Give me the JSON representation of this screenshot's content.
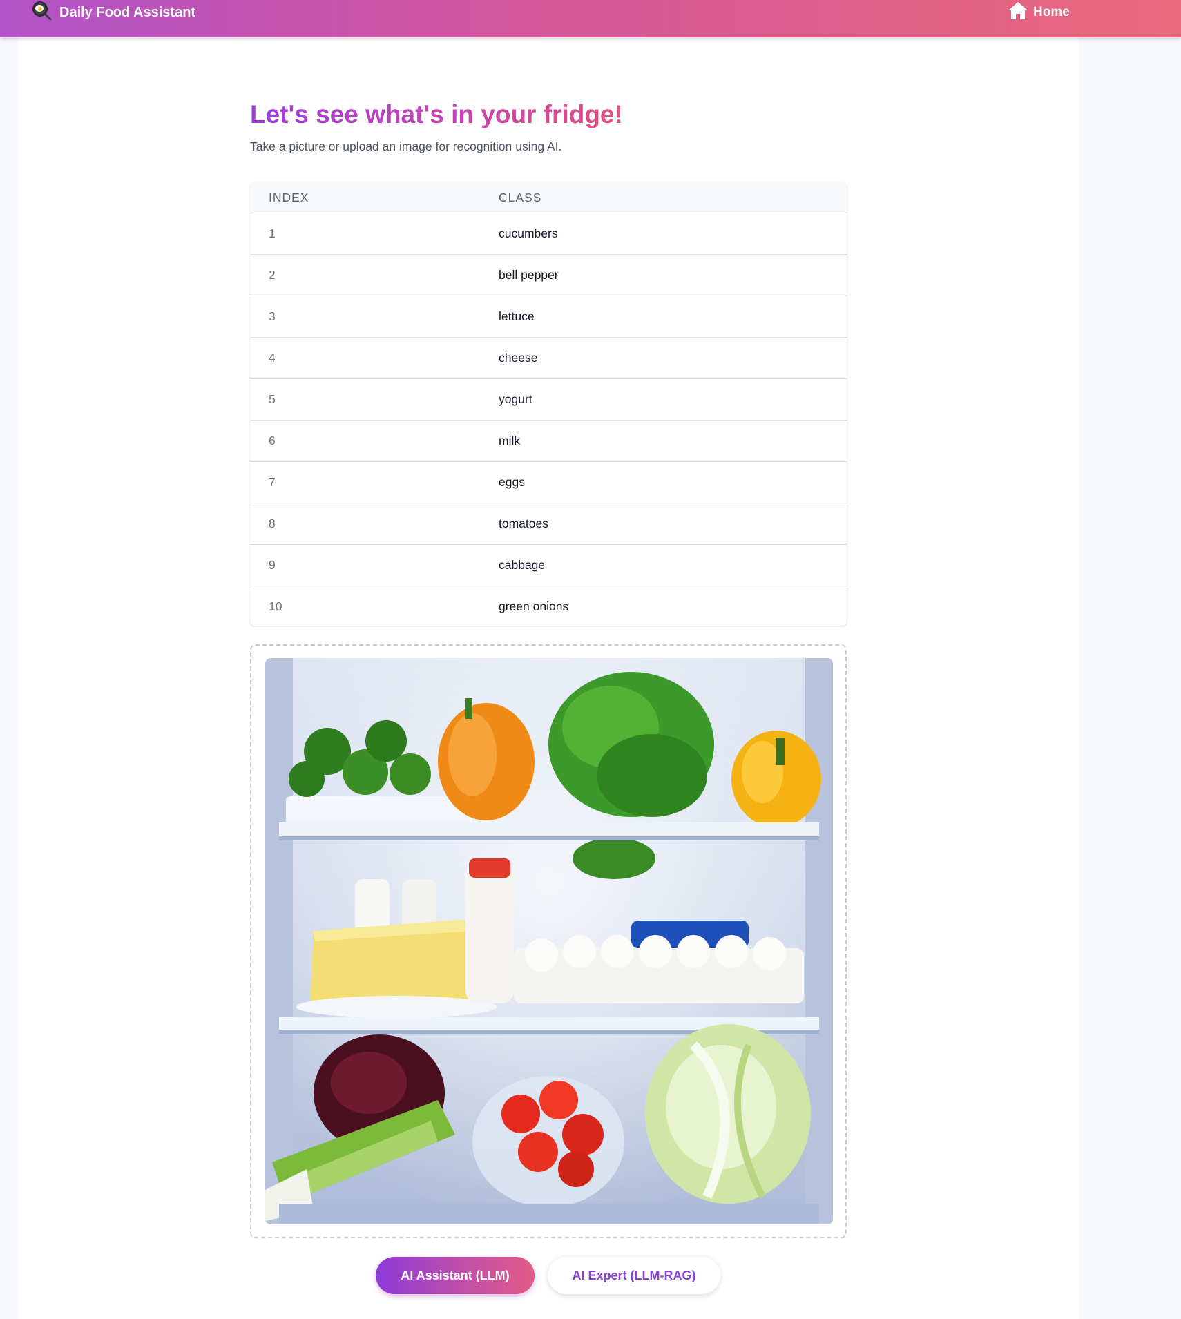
{
  "header": {
    "app_title": "Daily Food Assistant",
    "logo_icon": "frying-pan-icon",
    "home_label": "Home",
    "home_icon": "home-icon"
  },
  "main": {
    "title": "Let's see what's in your fridge!",
    "subtitle": "Take a picture or upload an image for recognition using AI.",
    "table": {
      "columns": [
        "INDEX",
        "CLASS"
      ],
      "rows": [
        {
          "index": "1",
          "class": "cucumbers"
        },
        {
          "index": "2",
          "class": "bell pepper"
        },
        {
          "index": "3",
          "class": "lettuce"
        },
        {
          "index": "4",
          "class": "cheese"
        },
        {
          "index": "5",
          "class": "yogurt"
        },
        {
          "index": "6",
          "class": "milk"
        },
        {
          "index": "7",
          "class": "eggs"
        },
        {
          "index": "8",
          "class": "tomatoes"
        },
        {
          "index": "9",
          "class": "cabbage"
        },
        {
          "index": "10",
          "class": "green onions"
        }
      ]
    },
    "buttons": {
      "primary_label": "AI Assistant (LLM)",
      "secondary_label": "AI Expert (LLM-RAG)"
    }
  },
  "colors": {
    "header_gradient_start": "#b153c8",
    "header_gradient_end": "#e86a7a",
    "accent_purple": "#8b3fd6",
    "accent_pink": "#e2507e"
  }
}
